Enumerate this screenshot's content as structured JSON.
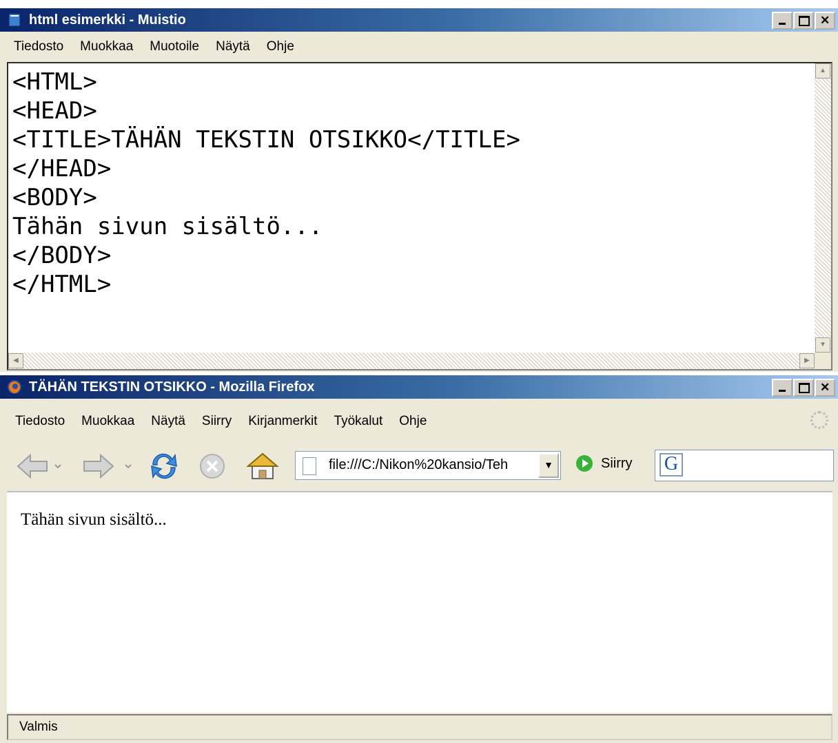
{
  "notepad": {
    "title": "html esimerkki - Muistio",
    "menu": [
      "Tiedosto",
      "Muokkaa",
      "Muotoile",
      "Näytä",
      "Ohje"
    ],
    "content_lines": [
      "<HTML>",
      "<HEAD>",
      "<TITLE>TÄHÄN TEKSTIN OTSIKKO</TITLE>",
      "</HEAD>",
      "<BODY>",
      "Tähän sivun sisältö...",
      "</BODY>",
      "</HTML>"
    ]
  },
  "firefox": {
    "title": "TÄHÄN TEKSTIN OTSIKKO - Mozilla Firefox",
    "menu": [
      "Tiedosto",
      "Muokkaa",
      "Näytä",
      "Siirry",
      "Kirjanmerkit",
      "Työkalut",
      "Ohje"
    ],
    "address": "file:///C:/Nikon%20kansio/Teh",
    "go_label": "Siirry",
    "search_engine_letter": "G",
    "page_text": "Tähän sivun sisältö...",
    "status": "Valmis"
  },
  "colors": {
    "titlebar_start": "#0a246a",
    "titlebar_end": "#a6caf0",
    "chrome": "#ece9d8"
  },
  "icons": [
    "notepad-icon",
    "firefox-icon",
    "back-icon",
    "forward-icon",
    "reload-icon",
    "stop-icon",
    "home-icon",
    "page-icon",
    "go-icon",
    "google-icon",
    "throbber-icon"
  ]
}
